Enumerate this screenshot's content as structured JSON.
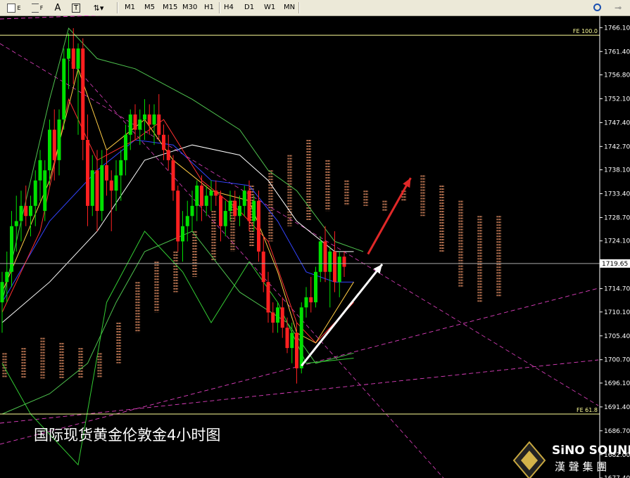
{
  "toolbar": {
    "tools": [
      {
        "label": "E",
        "icon": "indicator-list-icon"
      },
      {
        "label": "F",
        "icon": "fibonacci-icon"
      },
      {
        "label": "A",
        "icon": "text-label-icon"
      },
      {
        "label": "T",
        "icon": "text-tool-icon"
      },
      {
        "label": "",
        "icon": "arrows-icon"
      }
    ],
    "timeframes": [
      "M1",
      "M5",
      "M15",
      "M30",
      "H1",
      "H4",
      "D1",
      "W1",
      "MN"
    ]
  },
  "colors": {
    "background": "#000000",
    "bull_candle": "#00e000",
    "bear_candle": "#ff2020",
    "cloud": "#ff9f70",
    "fib_line": "#ffff99",
    "channel": "#e040c0"
  },
  "chart_data": {
    "type": "candlestick",
    "title": "国际现货黄金伦敦金4小时图",
    "y_axis": {
      "ticks": [
        "1766.10",
        "1761.40",
        "1756.80",
        "1752.10",
        "1747.40",
        "1742.70",
        "1738.10",
        "1733.40",
        "1728.70",
        "1724.10",
        "1719.40",
        "1714.70",
        "1710.10",
        "1705.40",
        "1700.70",
        "1696.10",
        "1691.40",
        "1686.70",
        "1682.00",
        "1677.40"
      ],
      "range": [
        1677.4,
        1768.5
      ],
      "side": "right"
    },
    "current_price": "1719.65",
    "fib_levels": [
      {
        "label": "FE 100.0",
        "value": 1764.6
      },
      {
        "label": "FE 61.8",
        "value": 1690.0
      }
    ],
    "candles": [
      {
        "o": 1712,
        "h": 1718,
        "l": 1706,
        "c": 1716
      },
      {
        "o": 1716,
        "h": 1722,
        "l": 1712,
        "c": 1718
      },
      {
        "o": 1718,
        "h": 1730,
        "l": 1715,
        "c": 1727
      },
      {
        "o": 1727,
        "h": 1733,
        "l": 1722,
        "c": 1728
      },
      {
        "o": 1728,
        "h": 1734,
        "l": 1724,
        "c": 1731
      },
      {
        "o": 1731,
        "h": 1735,
        "l": 1727,
        "c": 1729
      },
      {
        "o": 1729,
        "h": 1733,
        "l": 1725,
        "c": 1731
      },
      {
        "o": 1731,
        "h": 1738,
        "l": 1727,
        "c": 1736
      },
      {
        "o": 1736,
        "h": 1742,
        "l": 1732,
        "c": 1740
      },
      {
        "o": 1730,
        "h": 1740,
        "l": 1728,
        "c": 1738
      },
      {
        "o": 1738,
        "h": 1748,
        "l": 1735,
        "c": 1746
      },
      {
        "o": 1746,
        "h": 1750,
        "l": 1736,
        "c": 1740
      },
      {
        "o": 1740,
        "h": 1750,
        "l": 1737,
        "c": 1748
      },
      {
        "o": 1748,
        "h": 1762,
        "l": 1746,
        "c": 1760
      },
      {
        "o": 1760,
        "h": 1765,
        "l": 1754,
        "c": 1762
      },
      {
        "o": 1762,
        "h": 1766,
        "l": 1755,
        "c": 1758
      },
      {
        "o": 1758,
        "h": 1763,
        "l": 1745,
        "c": 1762
      },
      {
        "o": 1762,
        "h": 1764,
        "l": 1740,
        "c": 1744
      },
      {
        "o": 1744,
        "h": 1749,
        "l": 1727,
        "c": 1731
      },
      {
        "o": 1731,
        "h": 1741,
        "l": 1729,
        "c": 1738
      },
      {
        "o": 1738,
        "h": 1742,
        "l": 1726,
        "c": 1730
      },
      {
        "o": 1730,
        "h": 1742,
        "l": 1728,
        "c": 1739
      },
      {
        "o": 1739,
        "h": 1742,
        "l": 1733,
        "c": 1736
      },
      {
        "o": 1736,
        "h": 1738,
        "l": 1726,
        "c": 1734
      },
      {
        "o": 1734,
        "h": 1740,
        "l": 1730,
        "c": 1737
      },
      {
        "o": 1737,
        "h": 1742,
        "l": 1732,
        "c": 1740
      },
      {
        "o": 1740,
        "h": 1747,
        "l": 1737,
        "c": 1745
      },
      {
        "o": 1745,
        "h": 1750,
        "l": 1742,
        "c": 1749
      },
      {
        "o": 1749,
        "h": 1751,
        "l": 1744,
        "c": 1746
      },
      {
        "o": 1746,
        "h": 1750,
        "l": 1743,
        "c": 1748
      },
      {
        "o": 1748,
        "h": 1752,
        "l": 1744,
        "c": 1749
      },
      {
        "o": 1749,
        "h": 1751,
        "l": 1745,
        "c": 1747
      },
      {
        "o": 1747,
        "h": 1751,
        "l": 1743,
        "c": 1749
      },
      {
        "o": 1749,
        "h": 1753,
        "l": 1744,
        "c": 1745
      },
      {
        "o": 1745,
        "h": 1747,
        "l": 1740,
        "c": 1742
      },
      {
        "o": 1742,
        "h": 1745,
        "l": 1738,
        "c": 1740
      },
      {
        "o": 1740,
        "h": 1741,
        "l": 1732,
        "c": 1734
      },
      {
        "o": 1734,
        "h": 1735,
        "l": 1722,
        "c": 1724
      },
      {
        "o": 1724,
        "h": 1730,
        "l": 1720,
        "c": 1727
      },
      {
        "o": 1727,
        "h": 1732,
        "l": 1724,
        "c": 1729
      },
      {
        "o": 1729,
        "h": 1734,
        "l": 1726,
        "c": 1731
      },
      {
        "o": 1731,
        "h": 1736,
        "l": 1728,
        "c": 1735
      },
      {
        "o": 1735,
        "h": 1737,
        "l": 1728,
        "c": 1731
      },
      {
        "o": 1731,
        "h": 1735,
        "l": 1729,
        "c": 1733
      },
      {
        "o": 1733,
        "h": 1736,
        "l": 1730,
        "c": 1734
      },
      {
        "o": 1734,
        "h": 1736,
        "l": 1731,
        "c": 1733
      },
      {
        "o": 1733,
        "h": 1734,
        "l": 1724,
        "c": 1727
      },
      {
        "o": 1727,
        "h": 1732,
        "l": 1725,
        "c": 1730
      },
      {
        "o": 1730,
        "h": 1734,
        "l": 1728,
        "c": 1732
      },
      {
        "o": 1732,
        "h": 1734,
        "l": 1728,
        "c": 1729
      },
      {
        "o": 1729,
        "h": 1733,
        "l": 1727,
        "c": 1731
      },
      {
        "o": 1731,
        "h": 1735,
        "l": 1729,
        "c": 1734
      },
      {
        "o": 1734,
        "h": 1736,
        "l": 1726,
        "c": 1728
      },
      {
        "o": 1728,
        "h": 1733,
        "l": 1726,
        "c": 1732
      },
      {
        "o": 1732,
        "h": 1734,
        "l": 1720,
        "c": 1722
      },
      {
        "o": 1722,
        "h": 1725,
        "l": 1714,
        "c": 1716
      },
      {
        "o": 1716,
        "h": 1718,
        "l": 1708,
        "c": 1710
      },
      {
        "o": 1710,
        "h": 1712,
        "l": 1706,
        "c": 1708
      },
      {
        "o": 1708,
        "h": 1712,
        "l": 1706,
        "c": 1711
      },
      {
        "o": 1711,
        "h": 1713,
        "l": 1705,
        "c": 1707
      },
      {
        "o": 1707,
        "h": 1709,
        "l": 1702,
        "c": 1703
      },
      {
        "o": 1703,
        "h": 1708,
        "l": 1700,
        "c": 1706
      },
      {
        "o": 1706,
        "h": 1708,
        "l": 1696,
        "c": 1699
      },
      {
        "o": 1699,
        "h": 1712,
        "l": 1698,
        "c": 1711
      },
      {
        "o": 1711,
        "h": 1715,
        "l": 1709,
        "c": 1713
      },
      {
        "o": 1713,
        "h": 1717,
        "l": 1710,
        "c": 1712
      },
      {
        "o": 1712,
        "h": 1719,
        "l": 1711,
        "c": 1718
      },
      {
        "o": 1718,
        "h": 1725,
        "l": 1716,
        "c": 1724
      },
      {
        "o": 1724,
        "h": 1727,
        "l": 1716,
        "c": 1718
      },
      {
        "o": 1718,
        "h": 1723,
        "l": 1711,
        "c": 1722
      },
      {
        "o": 1722,
        "h": 1726,
        "l": 1714,
        "c": 1716
      },
      {
        "o": 1716,
        "h": 1722,
        "l": 1713,
        "c": 1721
      },
      {
        "o": 1721,
        "h": 1722,
        "l": 1717,
        "c": 1719
      }
    ]
  },
  "watermark": {
    "brand": "SiNO SOUND",
    "chinese": "漢 聲 集 團"
  }
}
